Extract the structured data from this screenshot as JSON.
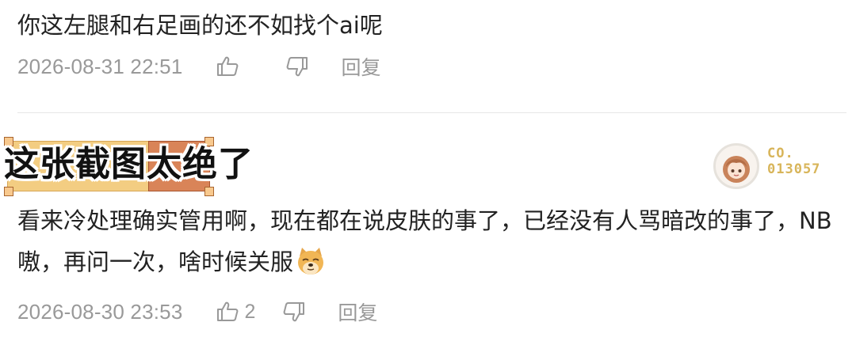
{
  "comments": [
    {
      "text": "你这左腿和右足画的还不如找个ai呢",
      "timestamp": "2026-08-31 22:51",
      "like_count": "",
      "reply_label": "回复"
    },
    {
      "text": "看来冷处理确实管用啊，现在都在说皮肤的事了，已经没有人骂暗改的事了，NB嗷，再问一次，啥时候关服",
      "emoji": "doge-emoji",
      "timestamp": "2026-08-30 23:53",
      "like_count": "2",
      "reply_label": "回复"
    }
  ],
  "overlay": {
    "caption": "这张截图太绝了"
  },
  "badge": {
    "line1": "CO.",
    "line2": "013057"
  },
  "icons": [
    "thumb-up-icon",
    "thumb-down-icon",
    "doge-emoji",
    "anime-avatar-badge"
  ],
  "colors": {
    "text": "#222222",
    "meta": "#999999",
    "highlight_yellow": "#f3cd82",
    "highlight_orange": "#d98458",
    "badge_gold": "#d8b55a"
  }
}
